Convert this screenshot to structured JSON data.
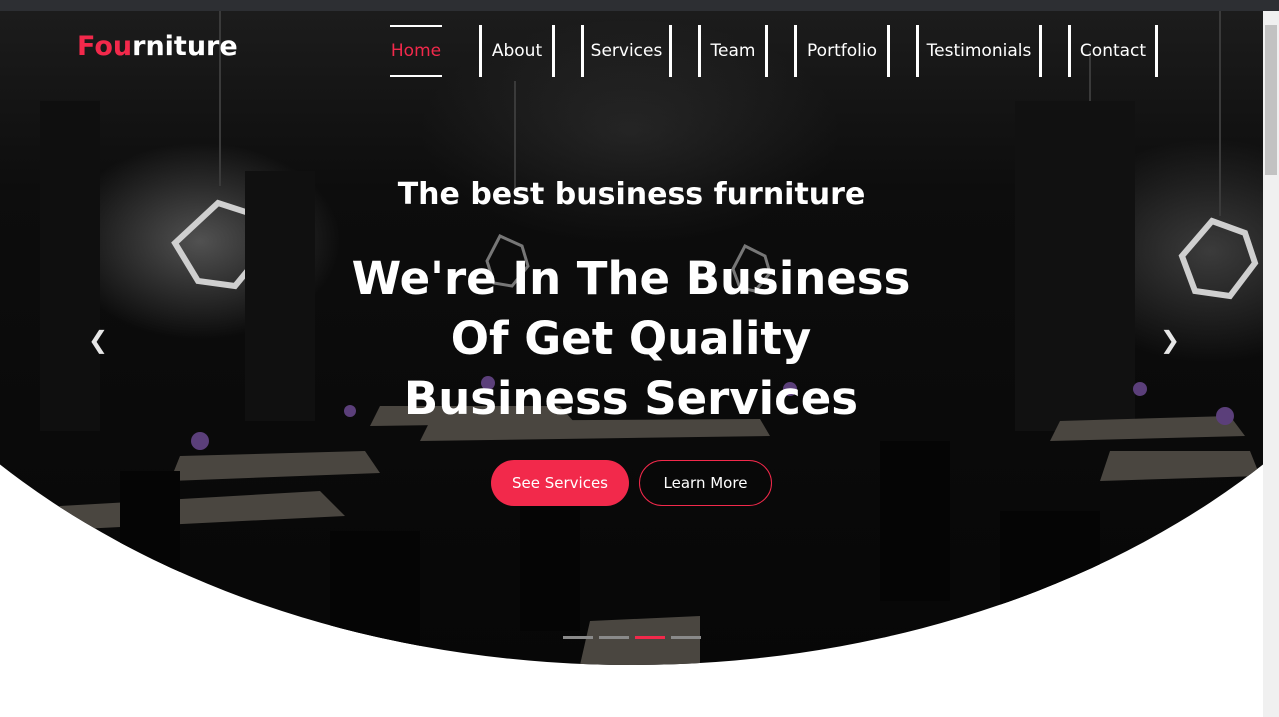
{
  "brand": {
    "logo_part1": "Fou",
    "logo_part2": "rniture"
  },
  "nav": {
    "items": [
      {
        "label": "Home"
      },
      {
        "label": "About"
      },
      {
        "label": "Services"
      },
      {
        "label": "Team"
      },
      {
        "label": "Portfolio"
      },
      {
        "label": "Testimonials"
      },
      {
        "label": "Contact"
      }
    ],
    "active": "Home"
  },
  "hero": {
    "subtitle": "The best business furniture",
    "headline": "We're In The Business Of Get Quality Business Services",
    "primary_button": "See Services",
    "secondary_button": "Learn More",
    "prev_icon": "chevron-left-icon",
    "next_icon": "chevron-right-icon",
    "slides_count": 4,
    "active_slide": 3
  },
  "colors": {
    "accent": "#f2294b",
    "text": "#ffffff",
    "dark": "#111111"
  }
}
